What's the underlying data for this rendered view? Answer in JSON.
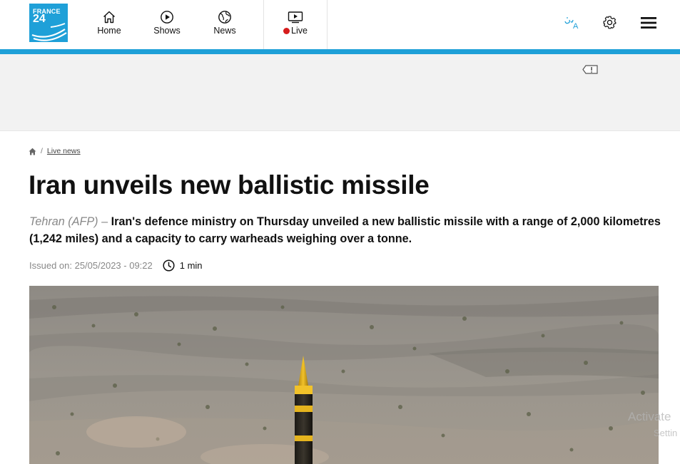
{
  "header": {
    "logo_line1": "FRANCE",
    "logo_line2": "24",
    "nav": {
      "home": "Home",
      "shows": "Shows",
      "news": "News",
      "live": "Live"
    },
    "accent_color": "#1fa0d8",
    "live_color": "#d61c1c"
  },
  "breadcrumb": {
    "separator": "/",
    "section": "Live news"
  },
  "article": {
    "title": "Iran unveils new ballistic missile",
    "dateline": "Tehran (AFP)",
    "dash": "–",
    "lead": "Iran's defence ministry on Thursday unveiled a new ballistic missile with a range of 2,000 kilometres (1,242 miles) and a capacity to carry warheads weighing over a tonne.",
    "issued": "Issued on: 25/05/2023 - 09:22",
    "read_time": "1 min"
  },
  "overlay": {
    "watermark_line1": "Activate",
    "watermark_line2": "Settin"
  }
}
